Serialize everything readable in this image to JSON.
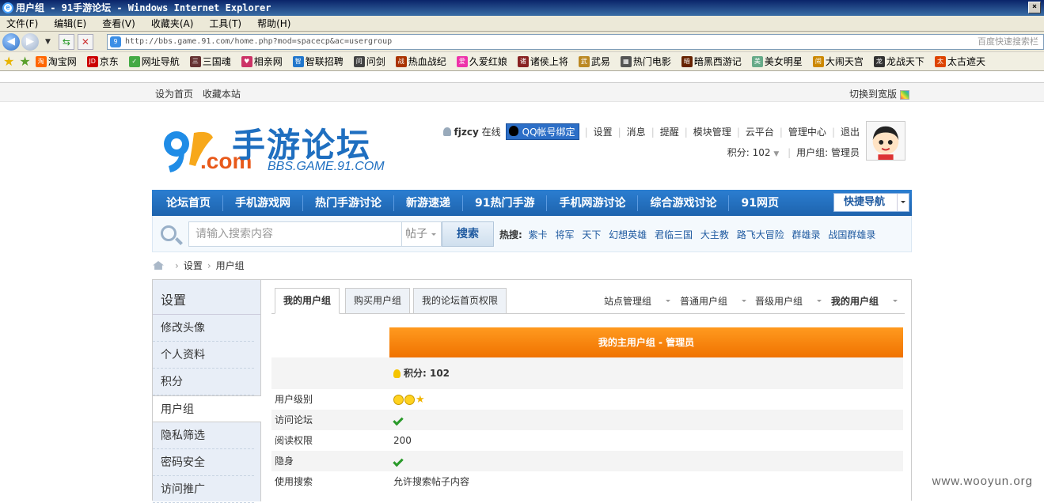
{
  "window": {
    "title": "用户组 - 91手游论坛 - Windows Internet Explorer"
  },
  "menu": [
    "文件(F)",
    "编辑(E)",
    "查看(V)",
    "收藏夹(A)",
    "工具(T)",
    "帮助(H)"
  ],
  "address": {
    "url": "http://bbs.game.91.com/home.php?mod=spacecp&ac=usergroup",
    "search_placeholder": "百度快速搜索栏"
  },
  "favorites": [
    "淘宝网",
    "京东",
    "网址导航",
    "三国魂",
    "相亲网",
    "智联招聘",
    "问剑",
    "热血战纪",
    "久爱红娘",
    "诸侯上将",
    "武易",
    "热门电影",
    "暗黑西游记",
    "美女明星",
    "大闹天宫",
    "龙战天下",
    "太古遮天"
  ],
  "top": {
    "left": [
      "设为首页",
      "收藏本站"
    ],
    "right": "切换到宽版"
  },
  "logo": {
    "cn": "手游论坛",
    "com": ".com",
    "en": "BBS.GAME.91.COM"
  },
  "user": {
    "name": "fjzcy",
    "status": "在线",
    "qq": "QQ帐号绑定",
    "links": [
      "设置",
      "消息",
      "提醒",
      "模块管理",
      "云平台",
      "管理中心",
      "退出"
    ],
    "points": "积分: 102",
    "group": "用户组: 管理员"
  },
  "nav": {
    "items": [
      "论坛首页",
      "手机游戏网",
      "热门手游讨论",
      "新游速递",
      "91热门手游",
      "手机网游讨论",
      "综合游戏讨论",
      "91网页"
    ],
    "quick": "快捷导航"
  },
  "search": {
    "placeholder": "请输入搜索内容",
    "type": "帖子",
    "button": "搜索",
    "hot_label": "热搜:",
    "hot": [
      "紫卡",
      "将军",
      "天下",
      "幻想英雄",
      "君临三国",
      "大主教",
      "路飞大冒险",
      "群雄录",
      "战国群雄录"
    ]
  },
  "breadcrumb": [
    "设置",
    "用户组"
  ],
  "sidebar": {
    "title": "设置",
    "items": [
      "修改头像",
      "个人资料",
      "积分",
      "用户组",
      "隐私筛选",
      "密码安全",
      "访问推广"
    ]
  },
  "tabs": [
    "我的用户组",
    "购买用户组",
    "我的论坛首页权限"
  ],
  "groups": [
    "站点管理组",
    "普通用户组",
    "晋级用户组",
    "我的用户组"
  ],
  "table": {
    "header": "我的主用户组 - 管理员",
    "points": "积分: 102",
    "rows": [
      {
        "k": "用户级别"
      },
      {
        "k": "访问论坛"
      },
      {
        "k": "阅读权限",
        "v": "200"
      },
      {
        "k": "隐身"
      },
      {
        "k": "使用搜索",
        "v": "允许搜索帖子内容"
      }
    ]
  },
  "watermark": "www.wooyun.org"
}
